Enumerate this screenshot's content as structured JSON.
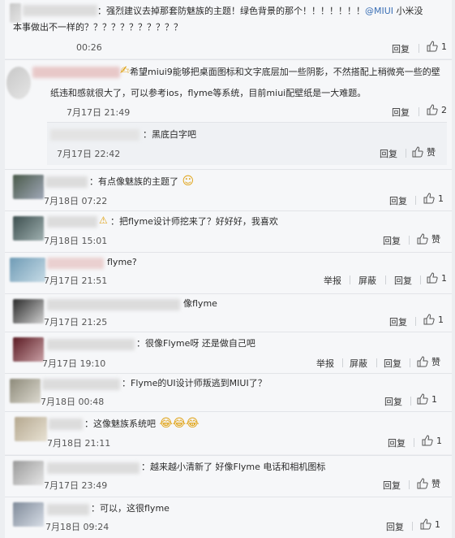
{
  "comments": [
    {
      "text_prefix": "：强烈建议去掉那套防魅族的主题！绿色背景的那个！！！！！！！",
      "mention": "@MIUI",
      "text_suffix": " 小米没",
      "text_line2": "本事做出不一样的？？？？？？？？？？？",
      "time": "00:26",
      "actions": [
        "回复"
      ],
      "likes": "1"
    },
    {
      "text_line1": "希望miui9能够把桌面图标和文字底层加一些阴影，不然搭配上稍微亮一些的壁",
      "text_line2": "纸违和感就很大了，可以参考ios，flyme等系统，目前miui配壁纸是一大难题。",
      "time": "7月17日 21:49",
      "actions": [
        "回复"
      ],
      "likes": "2"
    },
    {
      "text": "：黑底白字吧",
      "time": "7月17日 22:42",
      "actions": [
        "回复"
      ],
      "likes": "赞"
    },
    {
      "text": "：有点像魅族的主题了",
      "time": "7月18日 07:22",
      "actions": [
        "回复"
      ],
      "likes": "1"
    },
    {
      "text": "：把flyme设计师挖来了？好好好，我喜欢",
      "time": "7月18日 15:01",
      "actions": [
        "回复"
      ],
      "likes": "赞"
    },
    {
      "text": "flyme?",
      "time": "7月17日 21:51",
      "actions": [
        "举报",
        "屏蔽",
        "回复"
      ],
      "likes": "1"
    },
    {
      "text": "像flyme",
      "time": "7月17日 21:25",
      "actions": [
        "回复"
      ],
      "likes": "1"
    },
    {
      "text": "：很像Flyme呀 还是做自己吧",
      "time": "7月17日 19:10",
      "actions": [
        "举报",
        "屏蔽",
        "回复"
      ],
      "likes": "赞"
    },
    {
      "text": "：Flyme的UI设计师叛逃到MIUI了？",
      "time": "7月18日 00:48",
      "actions": [
        "回复"
      ],
      "likes": "1"
    },
    {
      "text": "：这像魅族系统吧",
      "time": "7月18日 21:11",
      "actions": [
        "回复"
      ],
      "likes": "1"
    },
    {
      "text": "：越来越小清新了 好像Flyme 电话和相机图标",
      "time": "7月17日 23:49",
      "actions": [
        "回复"
      ],
      "likes": "赞"
    },
    {
      "text": "：可以，这很flyme",
      "time": "7月18日 09:24",
      "actions": [
        "回复"
      ],
      "likes": "1"
    }
  ],
  "icons": {
    "like": "thumbs-up-icon",
    "emoji": "smiling-emoji-icon"
  },
  "colors": {
    "mention": "#3a6fb5",
    "background": "#eceef1"
  }
}
